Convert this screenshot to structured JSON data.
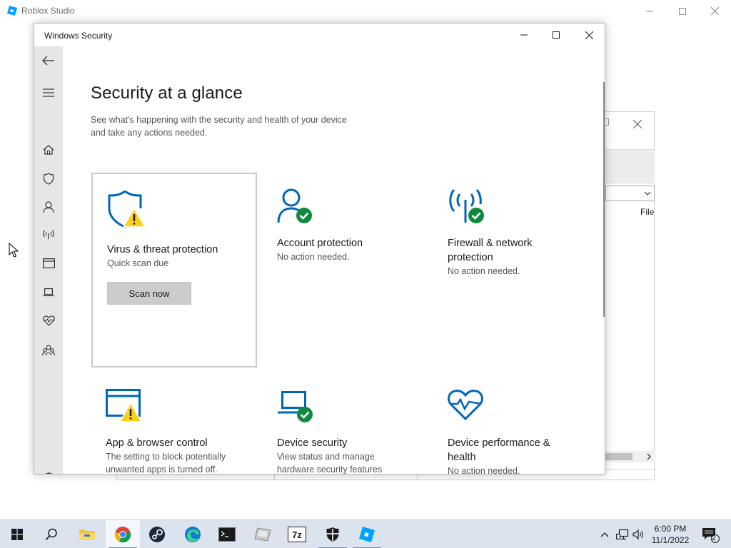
{
  "background_app": {
    "title": "Roblox Studio",
    "dialog_column_header": "File"
  },
  "window": {
    "title": "Windows Security"
  },
  "page": {
    "title": "Security at a glance",
    "subtitle_line1": "See what's happening with the security and health of your device",
    "subtitle_line2": "and take any actions needed."
  },
  "sidebar": {
    "items": [
      {
        "icon": "back-arrow-icon"
      },
      {
        "icon": "hamburger-menu-icon"
      },
      {
        "icon": "home-icon"
      },
      {
        "icon": "shield-icon"
      },
      {
        "icon": "person-icon"
      },
      {
        "icon": "wireless-antenna-icon"
      },
      {
        "icon": "app-browser-window-icon"
      },
      {
        "icon": "laptop-icon"
      },
      {
        "icon": "heart-health-icon"
      },
      {
        "icon": "family-icon"
      },
      {
        "icon": "gear-icon"
      }
    ]
  },
  "tiles": {
    "virus": {
      "title": "Virus & threat protection",
      "status": "Quick scan due",
      "button": "Scan now"
    },
    "account": {
      "title": "Account protection",
      "status": "No action needed."
    },
    "firewall": {
      "title_line1": "Firewall & network",
      "title_line2": "protection",
      "status": "No action needed."
    },
    "app_browser": {
      "title": "App & browser control",
      "status_line1": "The setting to block potentially",
      "status_line2": "unwanted apps is turned off."
    },
    "device_security": {
      "title": "Device security",
      "status_line1": "View status and manage",
      "status_line2": "hardware security features"
    },
    "device_performance": {
      "title_line1": "Device performance &",
      "title_line2": "health",
      "status": "No action needed."
    }
  },
  "colors": {
    "accent_blue": "#0067b8",
    "warning_yellow": "#fcd116",
    "ok_green": "#10893e",
    "sidebar_bg": "#e6e6e6",
    "taskbar_bg": "#dbe4ee"
  },
  "taskbar": {
    "apps": [
      "windows-start",
      "search",
      "file-explorer",
      "chrome",
      "steam",
      "edge",
      "command-prompt",
      "unknown-app",
      "7-zip",
      "windows-security",
      "roblox-studio"
    ],
    "clock_time": "6:00 PM",
    "clock_date": "11/1/2022",
    "notification_count": "2"
  }
}
